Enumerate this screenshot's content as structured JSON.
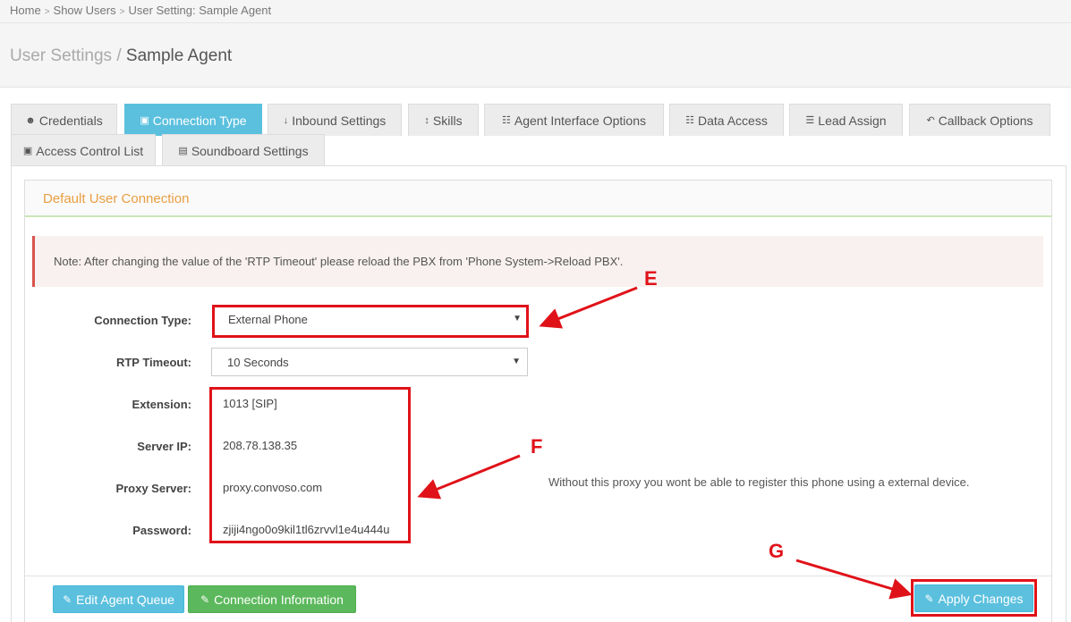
{
  "breadcrumb": [
    "Home",
    "Show Users",
    "User Setting: Sample Agent"
  ],
  "page_title": {
    "section": "User Settings",
    "separator": "/",
    "name": "Sample Agent"
  },
  "tabs": [
    {
      "label": "Credentials",
      "icon": "user-icon",
      "glyph": "☻"
    },
    {
      "label": "Connection Type",
      "icon": "lock-icon",
      "glyph": "▣"
    },
    {
      "label": "Inbound Settings",
      "icon": "arrow-down-icon",
      "glyph": "↓"
    },
    {
      "label": "Skills",
      "icon": "arrows-vertical-icon",
      "glyph": "↕"
    },
    {
      "label": "Agent Interface Options",
      "icon": "grid-icon",
      "glyph": "☷"
    },
    {
      "label": "Data Access",
      "icon": "grid-icon",
      "glyph": "☷"
    },
    {
      "label": "Lead Assign",
      "icon": "list-ol-icon",
      "glyph": "☰"
    },
    {
      "label": "Callback Options",
      "icon": "reply-all-icon",
      "glyph": "↶"
    },
    {
      "label": "Access Control List",
      "icon": "lock-icon",
      "glyph": "▣"
    },
    {
      "label": "Soundboard Settings",
      "icon": "file-audio-icon",
      "glyph": "▤"
    }
  ],
  "panel_heading": "Default User Connection",
  "note": "Note: After changing the value of the 'RTP Timeout' please reload the PBX from 'Phone System->Reload PBX'.",
  "form": {
    "connection_type_label": "Connection Type:",
    "connection_type_value": "External Phone",
    "rtp_timeout_label": "RTP Timeout:",
    "rtp_timeout_value": "10 Seconds",
    "extension_label": "Extension:",
    "extension_value": "1013 [SIP]",
    "server_ip_label": "Server IP:",
    "server_ip_value": "208.78.138.35",
    "proxy_server_label": "Proxy Server:",
    "proxy_server_value": "proxy.convoso.com",
    "password_label": "Password:",
    "password_value": "zjiji4ngo0o9kil1tl6zrvvl1e4u444u"
  },
  "helper_text": "Without this proxy you wont be able to register this phone using a external device.",
  "buttons": {
    "edit_agent_queue": "Edit Agent Queue",
    "connection_information": "Connection Information",
    "apply_changes": "Apply Changes"
  },
  "annotations": {
    "e": "E",
    "f": "F",
    "g": "G"
  },
  "colors": {
    "info": "#5bc0de",
    "success": "#5cb85c",
    "annotation": "#e01219",
    "heading": "#e99e41"
  }
}
